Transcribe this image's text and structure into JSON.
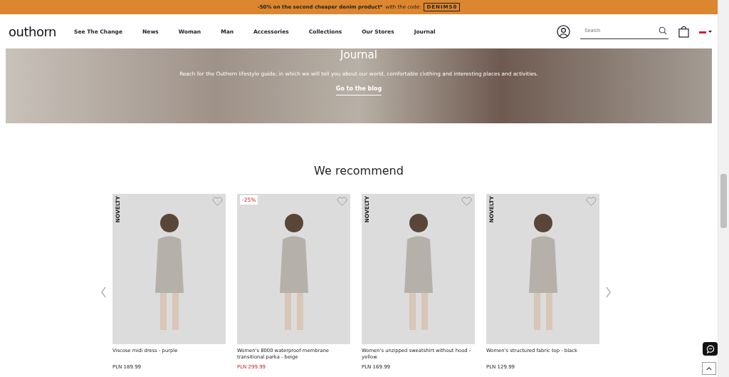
{
  "promo_bar": {
    "offer": "-50% on the second cheaper denim product*",
    "suffix": "with the code:",
    "code": "DENIM50"
  },
  "header": {
    "logo": "outhorn",
    "nav": [
      "See The Change",
      "News",
      "Woman",
      "Man",
      "Accessories",
      "Collections",
      "Our Stores",
      "Journal"
    ],
    "search": {
      "placeholder": "Search"
    }
  },
  "hero": {
    "title": "Journal",
    "text": "Reach for the Outhorn lifestyle guide, in which we will tell you about our world, comfortable clothing and interesting places and activities.",
    "link": "Go to the blog"
  },
  "recommend": {
    "title": "We recommend",
    "products": [
      {
        "name": "Viscose midi dress - purple",
        "price": "PLN 189.99",
        "sale": false,
        "badge": {
          "kind": "novelty",
          "text": "NOVELTY"
        }
      },
      {
        "name": "Women's 8000 waterproof membrane transitional parka - beige",
        "price": "PLN 299.99",
        "sale": true,
        "badge": {
          "kind": "discount",
          "text": "-25%"
        }
      },
      {
        "name": "Women's unzipped sweatshirt without hood - yellow",
        "price": "PLN 169.99",
        "sale": false,
        "badge": {
          "kind": "novelty",
          "text": "NOVELTY"
        }
      },
      {
        "name": "Women's structured fabric top - black",
        "price": "PLN 129.99",
        "sale": false,
        "badge": {
          "kind": "novelty",
          "text": "NOVELTY"
        }
      }
    ]
  }
}
